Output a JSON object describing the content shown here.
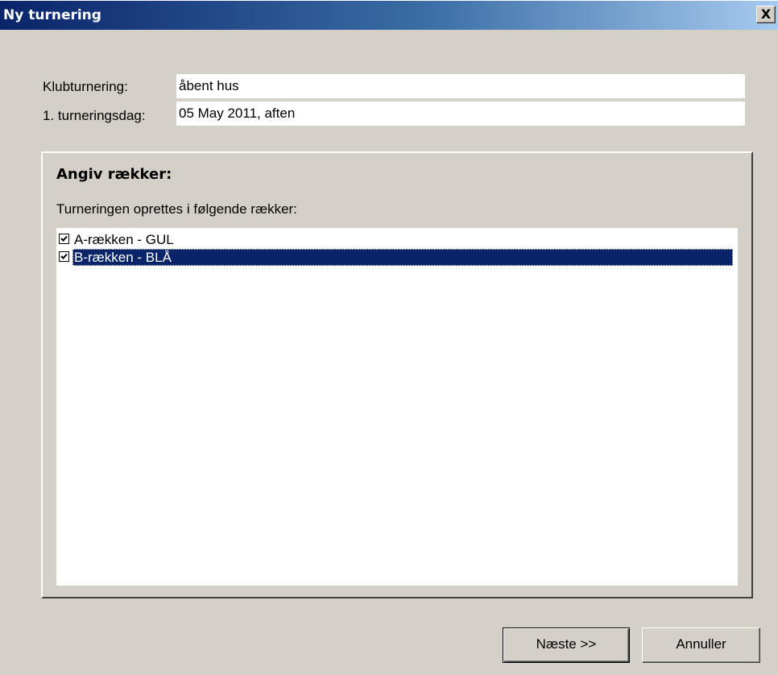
{
  "window": {
    "title": "Ny turnering",
    "close_label": "X"
  },
  "form": {
    "club_tournament_label": "Klubturnering:",
    "club_tournament_value": "åbent hus",
    "first_day_label": "1. turneringsdag:",
    "first_day_value": "05 May 2011, aften"
  },
  "group": {
    "title": "Angiv rækker:",
    "subtitle": "Turneringen oprettes i følgende rækker:",
    "items": [
      {
        "label": "A-rækken - GUL",
        "checked": true,
        "selected": false
      },
      {
        "label": "B-rækken - BLÅ",
        "checked": true,
        "selected": true
      }
    ]
  },
  "buttons": {
    "next_label": "Næste >>",
    "cancel_label": "Annuller"
  },
  "colors": {
    "selection": "#0a246a",
    "titlebar_start": "#0a246a",
    "titlebar_end": "#a6caf0",
    "dialog_bg": "#d4d0c8"
  }
}
